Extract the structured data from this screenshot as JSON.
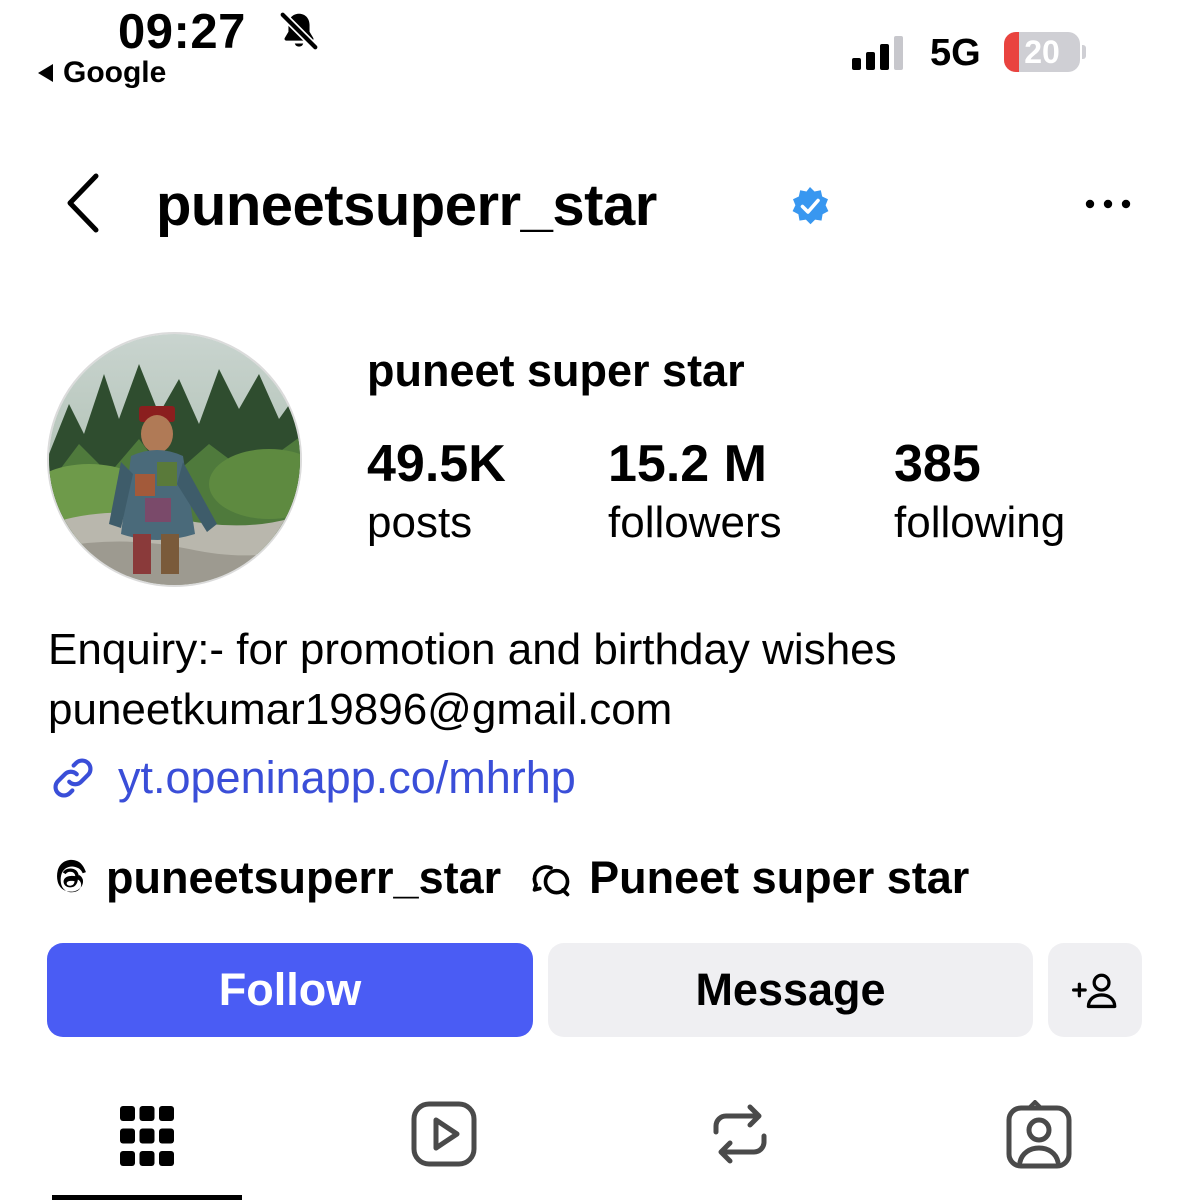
{
  "status_bar": {
    "time": "09:27",
    "back_app": "Google",
    "network": "5G",
    "battery_percent": "20",
    "signal_bars_active": 3,
    "battery_color": "#e9433f"
  },
  "header": {
    "username": "puneetsuperr_star",
    "verified": true,
    "back_icon": "chevron-left-icon",
    "more_icon": "more-horizontal-icon"
  },
  "profile": {
    "full_name": "puneet super star",
    "stats": [
      {
        "value": "49.5K",
        "label": "posts"
      },
      {
        "value": "15.2 M",
        "label": "followers"
      },
      {
        "value": "385",
        "label": "following"
      }
    ],
    "bio_lines": [
      "Enquiry:- for promotion and birthday wishes",
      "puneetkumar19896@gmail.com"
    ],
    "link": "yt.openinapp.co/mhrhp",
    "link_color": "#3a4ed8",
    "threads_handle": "puneetsuperr_star",
    "channel_name": "Puneet super star"
  },
  "actions": {
    "follow_label": "Follow",
    "message_label": "Message",
    "follow_color": "#4a5cf4",
    "add_user_icon": "add-user-icon"
  },
  "tabs": [
    {
      "icon": "grid-icon",
      "active": true
    },
    {
      "icon": "reels-icon",
      "active": false
    },
    {
      "icon": "reposts-icon",
      "active": false
    },
    {
      "icon": "tagged-icon",
      "active": false
    }
  ]
}
